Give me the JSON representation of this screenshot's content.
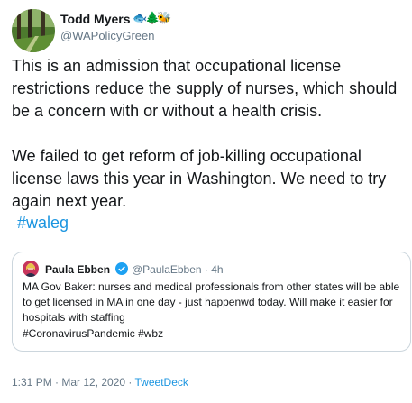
{
  "author": {
    "name": "Todd Myers",
    "handle": "@WAPolicyGreen",
    "name_emojis": [
      "🐟",
      "🌲",
      "🐝"
    ]
  },
  "tweet": {
    "text": "This is an admission that occupational license restrictions reduce the supply of nurses, which should be a concern with or without a health crisis.\n\nWe failed to get reform of job-killing occupational license laws this year in Washington. We need to try again next year.",
    "hashtag": "#waleg"
  },
  "quoted_tweet": {
    "name": "Paula Ebben",
    "handle_time": "@PaulaEbben · 4h",
    "text": "MA Gov Baker: nurses and medical professionals from other states will be able to get licensed in MA in one day - just happenwd today. Will make it easier for hospitals with staffing",
    "hashtags": "#CoronavirusPandemic #wbz"
  },
  "meta": {
    "timestamp": "1:31 PM · Mar 12, 2020 · ",
    "source": "TweetDeck"
  },
  "colors": {
    "link": "#1b95e0",
    "secondary_text": "#657786",
    "border": "#ccd6dd",
    "verified": "#1da1f2"
  },
  "icons": [
    "avatar-forest-icon",
    "avatar-person-icon",
    "verified-badge-icon"
  ]
}
